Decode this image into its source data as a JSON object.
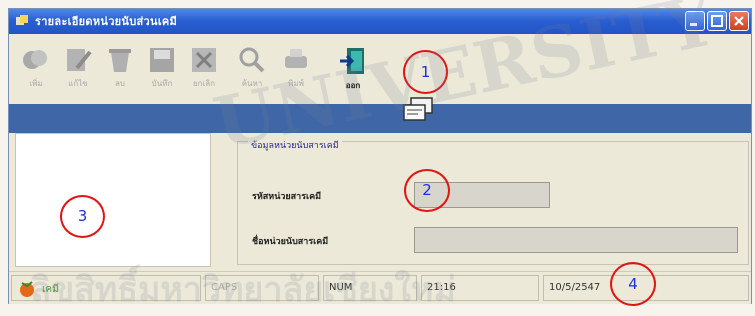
{
  "window": {
    "title": "รายละเอียดหน่วยนับส่วนเคมี"
  },
  "toolbar": {
    "items": [
      {
        "label": "เพิ่ม",
        "icon": "add-icon"
      },
      {
        "label": "แก้ไข",
        "icon": "edit-icon"
      },
      {
        "label": "ลบ",
        "icon": "delete-icon"
      },
      {
        "label": "บันทึก",
        "icon": "save-icon"
      },
      {
        "label": "ยกเลิก",
        "icon": "cancel-icon"
      },
      {
        "label": "ค้นหา",
        "icon": "search-icon"
      },
      {
        "label": "พิมพ์",
        "icon": "print-icon"
      },
      {
        "label": "ออก",
        "icon": "exit-icon"
      }
    ]
  },
  "group": {
    "legend": "ข้อมูลหน่วยนับสารเคมี",
    "fields": [
      {
        "label": "รหัสหน่วยสารเคมี",
        "value": ""
      },
      {
        "label": "ชื่อหน่วยนับสารเคมี",
        "value": ""
      }
    ]
  },
  "statusbar": {
    "user": "เคมี",
    "caps": "CAPS",
    "num": "NUM",
    "time": "21:16",
    "date": "10/5/2547"
  },
  "callouts": [
    "1",
    "2",
    "3",
    "4"
  ],
  "watermark": {
    "line1": "UNIVERSITY",
    "line2": "ลิขสิทธิ์มหาวิทยาลัยเชียงใหม่"
  },
  "colors": {
    "title_bar": "#2a5fd1",
    "band": "#3f67a8",
    "callout_ring": "#e01515",
    "callout_text": "#1c2fd8"
  }
}
